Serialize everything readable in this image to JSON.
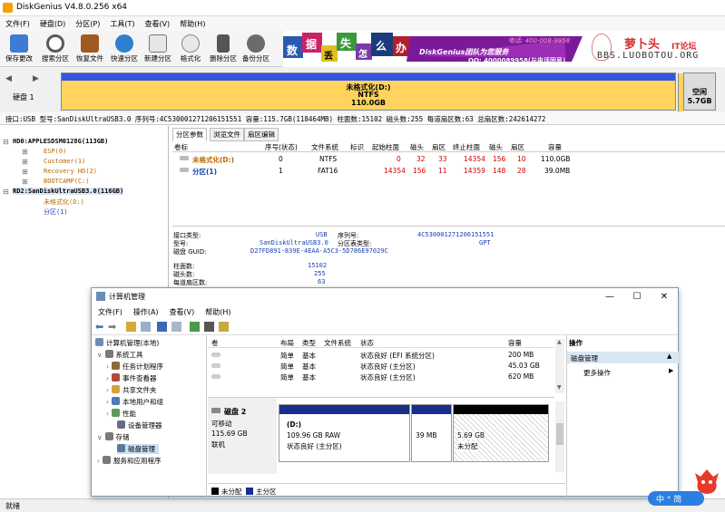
{
  "dg": {
    "title": "DiskGenius V4.8.0.256 x64",
    "menu": [
      "文件(F)",
      "硬盘(D)",
      "分区(P)",
      "工具(T)",
      "查看(V)",
      "帮助(H)"
    ],
    "toolbar": [
      {
        "label": "保存更改",
        "color": "#3d7bd6"
      },
      {
        "label": "搜索分区",
        "color": "#5a5a5a"
      },
      {
        "label": "恢复文件",
        "color": "#a05a20"
      },
      {
        "label": "快速分区",
        "color": "#2f7fd0"
      },
      {
        "label": "新建分区",
        "color": "#777777"
      },
      {
        "label": "格式化",
        "color": "#888888"
      },
      {
        "label": "删除分区",
        "color": "#555555"
      },
      {
        "label": "备份分区",
        "color": "#6b6b6b"
      }
    ],
    "banner": {
      "chars": [
        "数",
        "据",
        "丢",
        "失",
        "怎",
        "么",
        "办"
      ],
      "brand": "DiskGenius团队为您服务",
      "phone": "电话: 400-008-9958",
      "qq": "QQ: 4000089958(与电话同号)",
      "site_logo": "萝卜头",
      "site_sub": "IT论坛",
      "site_url": "BBS.LUOBOTOU.ORG"
    },
    "disk_label": "硬盘 1",
    "partition_bar": {
      "name": "未格式化(D:)",
      "fs": "NTFS",
      "size": "110.0GB"
    },
    "free_bar": {
      "name": "空闲",
      "size": "5.7GB"
    },
    "disk_info": "接口:USB  型号:SanDiskUltraUSB3.0  序列号:4C530001271206151551  容量:115.7GB(118464MB)  柱面数:15102  磁头数:255  每道扇区数:63  总扇区数:242614272",
    "tree": [
      {
        "text": "HD0:APPLESDSM0128G(113GB)",
        "style": "bold"
      },
      {
        "text": "ESP(0)",
        "style": "orange"
      },
      {
        "text": "Customer(1)",
        "style": "orange"
      },
      {
        "text": "Recovery HD(2)",
        "style": "orange"
      },
      {
        "text": "BOOTCAMP(C:)",
        "style": "orange"
      },
      {
        "text": "RD2:SanDiskUltraUSB3.0(116GB)",
        "style": "bold"
      },
      {
        "text": "未格式化(D:)",
        "style": "orange"
      },
      {
        "text": "分区(1)",
        "style": "blue"
      }
    ],
    "tabs": [
      "分区参数",
      "浏览文件",
      "扇区编辑"
    ],
    "ptable": {
      "headers": [
        "卷标",
        "序号(状态)",
        "文件系统",
        "标识",
        "起始柱面",
        "磁头",
        "扇区",
        "终止柱面",
        "磁头",
        "扇区",
        "容量"
      ],
      "rows": [
        [
          "未格式化(D:)",
          "0",
          "NTFS",
          "",
          "0",
          "32",
          "33",
          "14354",
          "156",
          "10",
          "110.0GB"
        ],
        [
          "分区(1)",
          "1",
          "FAT16",
          "",
          "14354",
          "156",
          "11",
          "14359",
          "148",
          "28",
          "39.0MB"
        ]
      ]
    },
    "details": {
      "iface_label": "接口类型:",
      "iface": "USB",
      "serial_label": "序列号:",
      "serial": "4C530001271206151551",
      "model_label": "型号:",
      "model": "SanDiskUltraUSB3.0",
      "ptype_label": "分区表类型:",
      "ptype": "GPT",
      "guid_label": "磁盘 GUID:",
      "guid": "D27FD891-839E-4EAA-A5C3-5D786E97029C",
      "cyl_label": "柱面数:",
      "cyl": "15102",
      "heads_label": "磁头数:",
      "heads": "255",
      "spt_label": "每道扇区数:",
      "spt": "63"
    },
    "status": "就绪"
  },
  "cm": {
    "title": "计算机管理",
    "menu": [
      "文件(F)",
      "操作(A)",
      "查看(V)",
      "帮助(H)"
    ],
    "tree": [
      {
        "text": "计算机管理(本地)",
        "indent": 0,
        "color": "#6a8cb8"
      },
      {
        "text": "系统工具",
        "indent": 1,
        "color": "#7a7a7a"
      },
      {
        "text": "任务计划程序",
        "indent": 2,
        "color": "#8a6a3a"
      },
      {
        "text": "事件查看器",
        "indent": 2,
        "color": "#b04a3a"
      },
      {
        "text": "共享文件夹",
        "indent": 2,
        "color": "#d4a43a"
      },
      {
        "text": "本地用户和组",
        "indent": 2,
        "color": "#4a7ab8"
      },
      {
        "text": "性能",
        "indent": 2,
        "color": "#5a9a5a"
      },
      {
        "text": "设备管理器",
        "indent": 2,
        "color": "#6a6a8a"
      },
      {
        "text": "存储",
        "indent": 1,
        "color": "#7a7a7a"
      },
      {
        "text": "磁盘管理",
        "indent": 2,
        "color": "#5a7a9a",
        "selected": true
      },
      {
        "text": "服务和应用程序",
        "indent": 1,
        "color": "#7a7a7a"
      }
    ],
    "vol_headers": [
      "卷",
      "布局",
      "类型",
      "文件系统",
      "状态",
      "容量"
    ],
    "volumes": [
      {
        "layout": "简单",
        "type": "基本",
        "status": "状态良好 (EFI 系统分区)",
        "cap": "200 MB"
      },
      {
        "layout": "简单",
        "type": "基本",
        "status": "状态良好 (主分区)",
        "cap": "45.03 GB"
      },
      {
        "layout": "简单",
        "type": "基本",
        "status": "状态良好 (主分区)",
        "cap": "620 MB"
      }
    ],
    "disk": {
      "name": "磁盘 2",
      "kind": "可移动",
      "size": "115.69 GB",
      "state": "联机"
    },
    "parts": [
      {
        "name": "(D:)",
        "size": "109.96 GB RAW",
        "status": "状态良好 (主分区)"
      },
      {
        "name": "",
        "size": "39 MB",
        "status": ""
      },
      {
        "name": "",
        "size": "5.69 GB",
        "status": "未分配"
      }
    ],
    "legend": [
      "未分配",
      "主分区"
    ],
    "actions": {
      "head": "操作",
      "selected": "磁盘管理",
      "more": "更多操作"
    }
  },
  "ime": "中 ° 简"
}
